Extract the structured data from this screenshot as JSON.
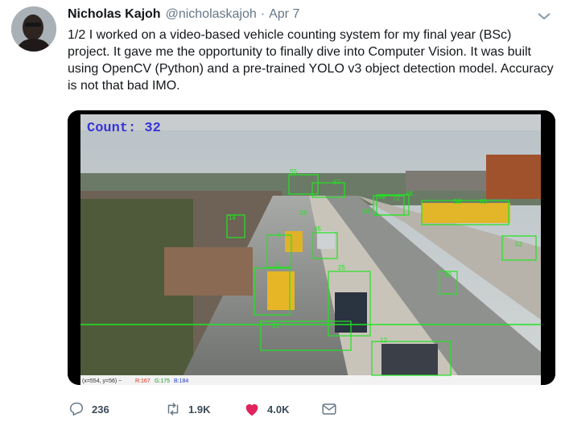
{
  "tweet": {
    "author_name": "Nicholas Kajoh",
    "handle": "@nicholaskajoh",
    "separator": "·",
    "date": "Apr 7",
    "text": "1/2 I worked on a video-based vehicle counting system for my final year (BSc) project. It gave me the opportunity to finally dive into Computer Vision. It was built using OpenCV (Python) and a pre-trained YOLO v3 object detection model. Accuracy is not that bad IMO."
  },
  "media": {
    "count_label": "Count: 32",
    "status_coords": "(x=554, y=56) ~",
    "status_r": "R:167",
    "status_g": "G:175",
    "status_b": "B:184",
    "detection_ids": [
      "55",
      "67",
      "48",
      "14",
      "7",
      "45",
      "3",
      "25",
      "31",
      "12",
      "58",
      "53",
      "40",
      "72",
      "63",
      "28",
      "34",
      "46"
    ],
    "colors": {
      "count_text": "#3535d8",
      "box": "#22e322",
      "status_r": "#e0301e",
      "status_g": "#1e9a2c",
      "status_b": "#2040d0"
    }
  },
  "actions": {
    "reply_count": "236",
    "retweet_count": "1.9K",
    "like_count": "4.0K"
  },
  "colors": {
    "like": "#e0245e",
    "muted": "#657786"
  }
}
